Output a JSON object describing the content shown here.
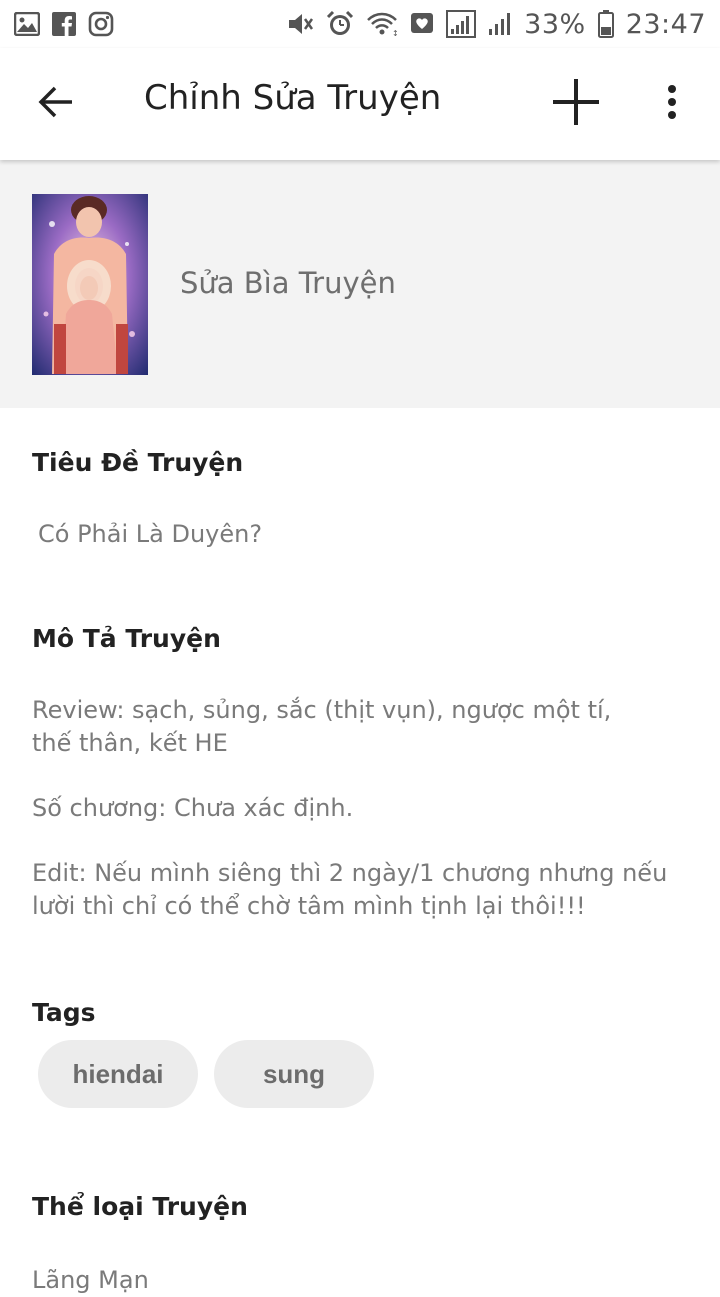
{
  "status_bar": {
    "battery": "33%",
    "time": "23:47",
    "icons_left": [
      "gallery-icon",
      "facebook-icon",
      "instagram-icon"
    ],
    "icons_right": [
      "mute-icon",
      "alarm-icon",
      "wifi-icon",
      "heart-chat-icon",
      "signal-icon",
      "signal-icon",
      "battery-icon"
    ]
  },
  "app_bar": {
    "title": "Chỉnh Sửa Truyện"
  },
  "cover": {
    "label": "Sửa Bìa Truyện"
  },
  "story": {
    "title_label": "Tiêu Đề Truyện",
    "title_value": "Có Phải Là Duyên?",
    "description_label": "Mô Tả Truyện",
    "description": {
      "line1": "Review: sạch, sủng, sắc (thịt vụn), ngược một tí,",
      "line2": "thế thân, kết HE",
      "line3": "Số chương: Chưa xác định.",
      "line4": "Edit: Nếu mình siêng thì 2 ngày/1 chương nhưng nếu",
      "line5": "lười thì chỉ có thể chờ tâm mình tịnh lại thôi!!!"
    },
    "tags_label": "Tags",
    "tags": [
      "hiendai",
      "sung"
    ],
    "genre_label": "Thể loại Truyện",
    "genre_value": "Lãng Mạn"
  },
  "colors": {
    "cover_section_bg": "#f3f3f3",
    "chip_bg": "#ececec"
  }
}
